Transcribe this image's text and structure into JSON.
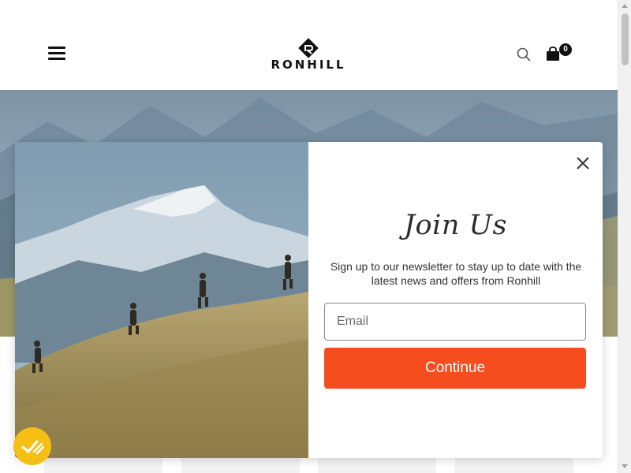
{
  "header": {
    "logo_text": "RONHILL",
    "menu_icon": "hamburger-icon",
    "search_icon": "search-icon",
    "cart_icon": "shopping-bag-icon",
    "cart_count": "0"
  },
  "modal": {
    "title": "Join Us",
    "description": "Sign up to our newsletter to stay up to date with the latest news and offers from Ronhill",
    "email_placeholder": "Email",
    "email_value": "",
    "continue_label": "Continue",
    "close_icon": "close-icon"
  },
  "accessibility": {
    "icon": "accessibility-icon"
  },
  "colors": {
    "accent": "#f54d1d",
    "badge": "#f5c016",
    "text": "#2b2b2b"
  }
}
